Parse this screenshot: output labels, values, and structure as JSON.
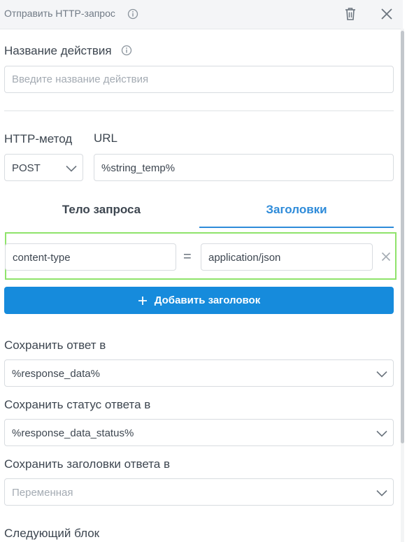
{
  "header": {
    "title": "Отправить HTTP-запрос"
  },
  "action_name": {
    "label": "Название действия",
    "placeholder": "Введите название действия",
    "value": ""
  },
  "http_method": {
    "label": "HTTP-метод",
    "value": "POST"
  },
  "url": {
    "label": "URL",
    "value": "%string_temp%"
  },
  "tabs": [
    {
      "label": "Тело запроса",
      "active": false
    },
    {
      "label": "Заголовки",
      "active": true
    }
  ],
  "headers": [
    {
      "key": "content-type",
      "separator": "=",
      "value": "application/json"
    }
  ],
  "add_header_button": {
    "label": "Добавить заголовок"
  },
  "save_response": {
    "label": "Сохранить ответ в",
    "value": "%response_data%"
  },
  "save_status": {
    "label": "Сохранить статус ответа в",
    "value": "%response_data_status%"
  },
  "save_headers": {
    "label": "Сохранить заголовки ответа в",
    "placeholder": "Переменная"
  },
  "next_block": {
    "label": "Следующий блок"
  },
  "colors": {
    "accent": "#168bdc",
    "tab_active": "#2e8bd9",
    "highlight_border": "#8fe36b",
    "text": "#3d4650",
    "muted": "#a4abb3"
  },
  "icons": {
    "info": "info-icon",
    "delete": "trash-icon",
    "close": "close-icon",
    "dropdown": "chevron-down-icon",
    "remove_header": "close-icon",
    "add": "plus-icon"
  }
}
